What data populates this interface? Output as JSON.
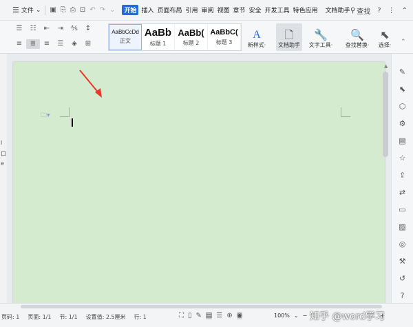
{
  "menu": {
    "file_label": "文件",
    "tabs": [
      "开始",
      "插入",
      "页面布局",
      "引用",
      "审阅",
      "视图",
      "章节",
      "安全",
      "开发工具",
      "特色应用",
      "文档助手"
    ],
    "search_label": "查找",
    "help": "?"
  },
  "ribbon": {
    "styles": [
      {
        "sample": "AaBbCcDd",
        "label": "正文"
      },
      {
        "sample": "AaBb",
        "label": "标题 1"
      },
      {
        "sample": "AaBb(",
        "label": "标题 2"
      },
      {
        "sample": "AaBbC(",
        "label": "标题 3"
      }
    ],
    "new_style": "新样式·",
    "doc_helper": "文档助手",
    "text_tools": "文字工具·",
    "find_replace": "查找替换·",
    "select": "选择·",
    "new_style_glyph": "A"
  },
  "status": {
    "page_num": "页码: 1",
    "pages": "页面: 1/1",
    "section": "节: 1/1",
    "setting": "设置值: 2.5厘米",
    "row": "行: 1",
    "zoom": "100%",
    "zoom_minus": "−",
    "zoom_plus": "+"
  },
  "watermark": "知乎 @word学习",
  "left_edge_chars": [
    "l",
    "口",
    "e"
  ],
  "colors": {
    "page": "#d4ebcf",
    "accent": "#1e6cde",
    "arrow": "#e8372c"
  }
}
